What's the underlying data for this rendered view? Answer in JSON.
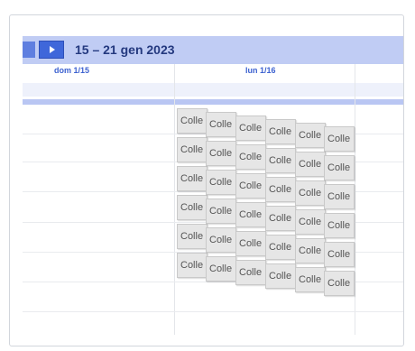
{
  "header": {
    "range_title": "15 – 21 gen 2023"
  },
  "columns": [
    {
      "label": "dom 1/15"
    },
    {
      "label": "lun 1/16"
    }
  ],
  "event_label": "Colle",
  "colors": {
    "header_bg": "#c0ccf4",
    "button": "#3f67da",
    "title_text": "#24397f",
    "day_label": "#3d62d0",
    "event_bg": "#e6e6e6"
  }
}
